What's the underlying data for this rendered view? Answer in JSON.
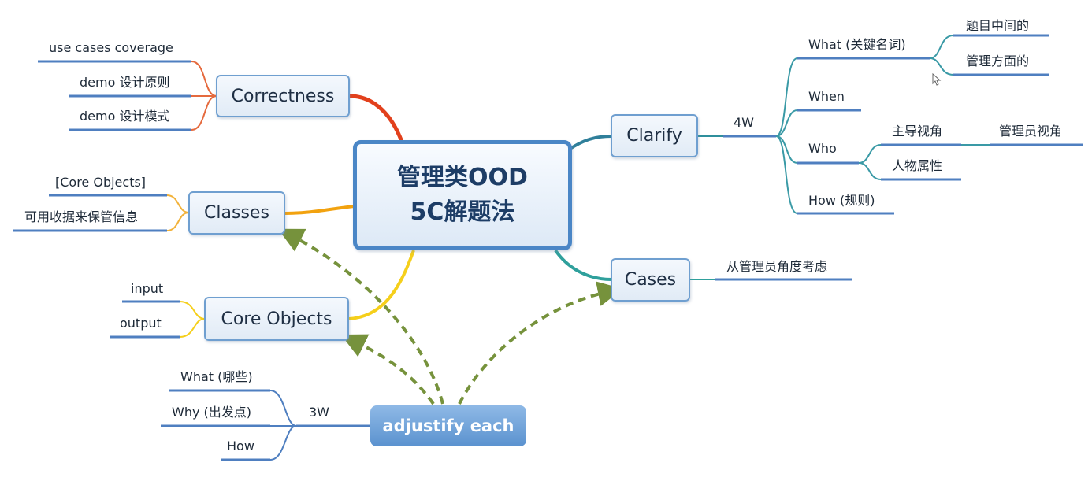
{
  "root": {
    "line1": "管理类OOD",
    "line2": "5C解题法"
  },
  "nodes": {
    "correctness": {
      "label": "Correctness",
      "children": [
        "use cases coverage",
        "demo 设计原则",
        "demo 设计模式"
      ]
    },
    "classes": {
      "label": "Classes",
      "children": [
        "[Core Objects]",
        "可用收据来保管信息"
      ]
    },
    "core_objects": {
      "label": "Core Objects",
      "children": [
        "input",
        "output"
      ]
    },
    "clarify": {
      "label": "Clarify",
      "branch": "4W",
      "what": {
        "label": "What (关键名词)",
        "children": [
          "题目中间的",
          "管理方面的"
        ]
      },
      "when": {
        "label": "When"
      },
      "who": {
        "label": "Who",
        "lead": "主导视角",
        "lead_child": "管理员视角",
        "attr": "人物属性"
      },
      "how": {
        "label": "How (规则)"
      }
    },
    "cases": {
      "label": "Cases",
      "children": [
        "从管理员角度考虑"
      ]
    },
    "adjust": {
      "label": "adjustify each",
      "branch": "3W",
      "children": [
        "What (哪些)",
        "Why (出发点)",
        "How"
      ]
    }
  },
  "colors": {
    "node_border": "#6f9fd0",
    "root_border": "#4a86c6",
    "leaf_underline": "#4f7fc0",
    "dashed_arrow": "#76923c",
    "correctness_branch": "#e2401c",
    "classes_branch": "#f2a20f",
    "core_objects_branch": "#f5cf1b",
    "clarify_branch": "#2f8f9c",
    "cases_branch": "#2f8f9c"
  }
}
